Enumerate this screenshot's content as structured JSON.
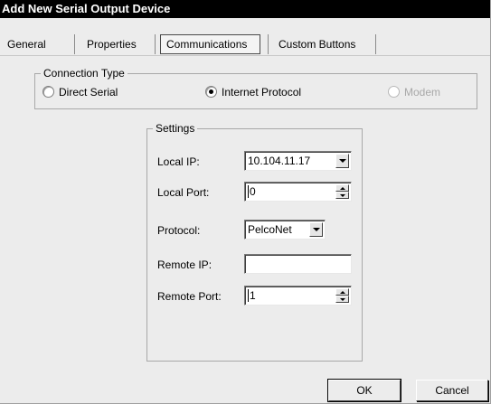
{
  "window": {
    "title": "Add New Serial Output Device"
  },
  "tabs": [
    {
      "label": "General",
      "active": false
    },
    {
      "label": "Properties",
      "active": false
    },
    {
      "label": "Communications",
      "active": true
    },
    {
      "label": "Custom Buttons",
      "active": false
    }
  ],
  "connection_type": {
    "legend": "Connection Type",
    "options": [
      {
        "label": "Direct Serial",
        "checked": false,
        "enabled": true
      },
      {
        "label": "Internet Protocol",
        "checked": true,
        "enabled": true
      },
      {
        "label": "Modem",
        "checked": false,
        "enabled": false
      }
    ]
  },
  "settings": {
    "legend": "Settings",
    "local_ip": {
      "label": "Local IP:",
      "value": "10.104.11.17"
    },
    "local_port": {
      "label": "Local Port:",
      "value": "0"
    },
    "protocol": {
      "label": "Protocol:",
      "value": "PelcoNet"
    },
    "remote_ip": {
      "label": "Remote IP:",
      "value": ""
    },
    "remote_port": {
      "label": "Remote Port:",
      "value": "1"
    }
  },
  "buttons": {
    "ok": "OK",
    "cancel": "Cancel"
  },
  "icons": {
    "dropdown": "chevron-down-icon",
    "spin_up": "spin-up-icon",
    "spin_down": "spin-down-icon"
  }
}
